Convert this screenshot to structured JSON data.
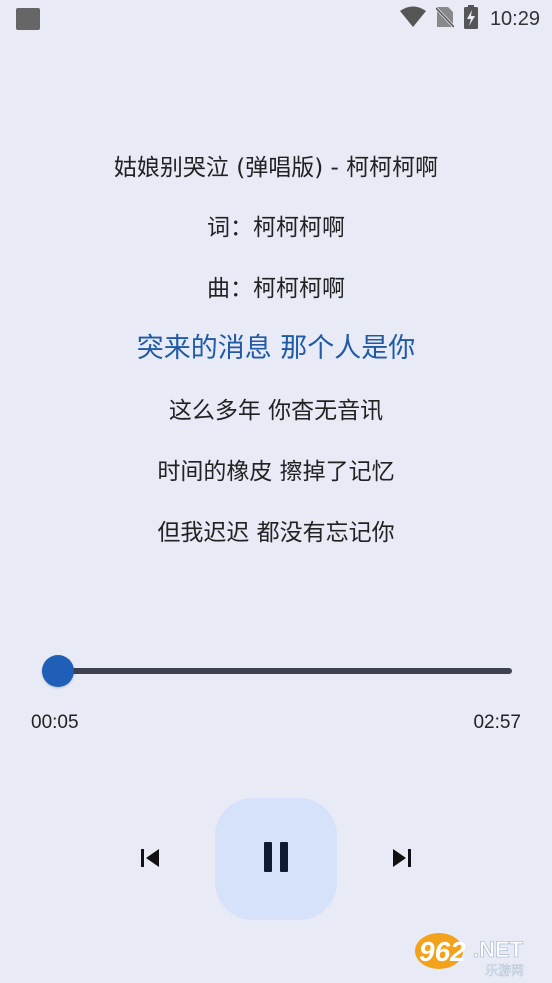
{
  "status_bar": {
    "time": "10:29",
    "icons": [
      "notification-square-icon",
      "wifi-icon",
      "no-sim-icon",
      "battery-charging-icon"
    ]
  },
  "lyrics": {
    "lines": [
      "姑娘别哭泣 (弹唱版) - 柯柯柯啊",
      "词：柯柯柯啊",
      "曲：柯柯柯啊",
      "突来的消息 那个人是你",
      "这么多年 你杳无音讯",
      "时间的橡皮 擦掉了记忆",
      "但我迟迟 都没有忘记你"
    ],
    "active_index": 3
  },
  "player": {
    "current_time": "00:05",
    "total_time": "02:57",
    "progress": 0.03
  },
  "controls": {
    "prev_icon": "skip-previous-icon",
    "play_pause_icon": "pause-icon",
    "next_icon": "skip-next-icon"
  },
  "watermark": {
    "brand": "962.NET",
    "subtitle": "乐游网"
  },
  "colors": {
    "background": "#e8eaf6",
    "accent": "#1f5fb8",
    "active_lyric": "#1e5aa6",
    "play_button_bg": "#d6e1fa"
  }
}
